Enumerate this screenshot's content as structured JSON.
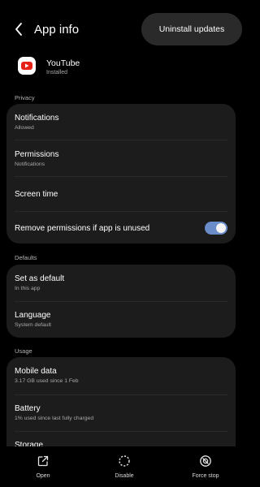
{
  "header": {
    "title": "App info",
    "uninstall_label": "Uninstall updates"
  },
  "app": {
    "name": "YouTube",
    "status": "Installed"
  },
  "sections": {
    "privacy": "Privacy",
    "defaults": "Defaults",
    "usage": "Usage"
  },
  "privacy_card": {
    "notifications": {
      "label": "Notifications",
      "sub": "Allowed"
    },
    "permissions": {
      "label": "Permissions",
      "sub": "Notifications"
    },
    "screen_time": {
      "label": "Screen time"
    },
    "remove_permissions": {
      "label": "Remove permissions if app is unused",
      "enabled": true
    }
  },
  "defaults_card": {
    "set_as_default": {
      "label": "Set as default",
      "sub": "In this app"
    },
    "language": {
      "label": "Language",
      "sub": "System default"
    }
  },
  "usage_card": {
    "mobile_data": {
      "label": "Mobile data",
      "sub": "3.17 GB used since 1 Feb"
    },
    "battery": {
      "label": "Battery",
      "sub": "1% used since last fully charged"
    },
    "storage": {
      "label": "Storage"
    }
  },
  "actions": {
    "open": "Open",
    "disable": "Disable",
    "force_stop": "Force stop"
  },
  "colors": {
    "toggle_on": "#6a8cc9",
    "card_bg": "#1c1c1c",
    "youtube_red": "#e62117"
  }
}
